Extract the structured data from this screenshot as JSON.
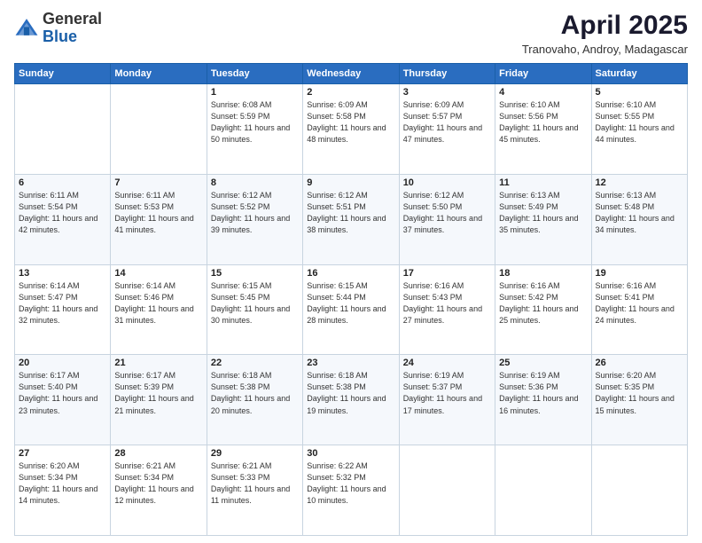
{
  "header": {
    "logo_general": "General",
    "logo_blue": "Blue",
    "month_year": "April 2025",
    "location": "Tranovaho, Androy, Madagascar"
  },
  "days_of_week": [
    "Sunday",
    "Monday",
    "Tuesday",
    "Wednesday",
    "Thursday",
    "Friday",
    "Saturday"
  ],
  "weeks": [
    [
      {
        "day": "",
        "info": ""
      },
      {
        "day": "",
        "info": ""
      },
      {
        "day": "1",
        "info": "Sunrise: 6:08 AM\nSunset: 5:59 PM\nDaylight: 11 hours and 50 minutes."
      },
      {
        "day": "2",
        "info": "Sunrise: 6:09 AM\nSunset: 5:58 PM\nDaylight: 11 hours and 48 minutes."
      },
      {
        "day": "3",
        "info": "Sunrise: 6:09 AM\nSunset: 5:57 PM\nDaylight: 11 hours and 47 minutes."
      },
      {
        "day": "4",
        "info": "Sunrise: 6:10 AM\nSunset: 5:56 PM\nDaylight: 11 hours and 45 minutes."
      },
      {
        "day": "5",
        "info": "Sunrise: 6:10 AM\nSunset: 5:55 PM\nDaylight: 11 hours and 44 minutes."
      }
    ],
    [
      {
        "day": "6",
        "info": "Sunrise: 6:11 AM\nSunset: 5:54 PM\nDaylight: 11 hours and 42 minutes."
      },
      {
        "day": "7",
        "info": "Sunrise: 6:11 AM\nSunset: 5:53 PM\nDaylight: 11 hours and 41 minutes."
      },
      {
        "day": "8",
        "info": "Sunrise: 6:12 AM\nSunset: 5:52 PM\nDaylight: 11 hours and 39 minutes."
      },
      {
        "day": "9",
        "info": "Sunrise: 6:12 AM\nSunset: 5:51 PM\nDaylight: 11 hours and 38 minutes."
      },
      {
        "day": "10",
        "info": "Sunrise: 6:12 AM\nSunset: 5:50 PM\nDaylight: 11 hours and 37 minutes."
      },
      {
        "day": "11",
        "info": "Sunrise: 6:13 AM\nSunset: 5:49 PM\nDaylight: 11 hours and 35 minutes."
      },
      {
        "day": "12",
        "info": "Sunrise: 6:13 AM\nSunset: 5:48 PM\nDaylight: 11 hours and 34 minutes."
      }
    ],
    [
      {
        "day": "13",
        "info": "Sunrise: 6:14 AM\nSunset: 5:47 PM\nDaylight: 11 hours and 32 minutes."
      },
      {
        "day": "14",
        "info": "Sunrise: 6:14 AM\nSunset: 5:46 PM\nDaylight: 11 hours and 31 minutes."
      },
      {
        "day": "15",
        "info": "Sunrise: 6:15 AM\nSunset: 5:45 PM\nDaylight: 11 hours and 30 minutes."
      },
      {
        "day": "16",
        "info": "Sunrise: 6:15 AM\nSunset: 5:44 PM\nDaylight: 11 hours and 28 minutes."
      },
      {
        "day": "17",
        "info": "Sunrise: 6:16 AM\nSunset: 5:43 PM\nDaylight: 11 hours and 27 minutes."
      },
      {
        "day": "18",
        "info": "Sunrise: 6:16 AM\nSunset: 5:42 PM\nDaylight: 11 hours and 25 minutes."
      },
      {
        "day": "19",
        "info": "Sunrise: 6:16 AM\nSunset: 5:41 PM\nDaylight: 11 hours and 24 minutes."
      }
    ],
    [
      {
        "day": "20",
        "info": "Sunrise: 6:17 AM\nSunset: 5:40 PM\nDaylight: 11 hours and 23 minutes."
      },
      {
        "day": "21",
        "info": "Sunrise: 6:17 AM\nSunset: 5:39 PM\nDaylight: 11 hours and 21 minutes."
      },
      {
        "day": "22",
        "info": "Sunrise: 6:18 AM\nSunset: 5:38 PM\nDaylight: 11 hours and 20 minutes."
      },
      {
        "day": "23",
        "info": "Sunrise: 6:18 AM\nSunset: 5:38 PM\nDaylight: 11 hours and 19 minutes."
      },
      {
        "day": "24",
        "info": "Sunrise: 6:19 AM\nSunset: 5:37 PM\nDaylight: 11 hours and 17 minutes."
      },
      {
        "day": "25",
        "info": "Sunrise: 6:19 AM\nSunset: 5:36 PM\nDaylight: 11 hours and 16 minutes."
      },
      {
        "day": "26",
        "info": "Sunrise: 6:20 AM\nSunset: 5:35 PM\nDaylight: 11 hours and 15 minutes."
      }
    ],
    [
      {
        "day": "27",
        "info": "Sunrise: 6:20 AM\nSunset: 5:34 PM\nDaylight: 11 hours and 14 minutes."
      },
      {
        "day": "28",
        "info": "Sunrise: 6:21 AM\nSunset: 5:34 PM\nDaylight: 11 hours and 12 minutes."
      },
      {
        "day": "29",
        "info": "Sunrise: 6:21 AM\nSunset: 5:33 PM\nDaylight: 11 hours and 11 minutes."
      },
      {
        "day": "30",
        "info": "Sunrise: 6:22 AM\nSunset: 5:32 PM\nDaylight: 11 hours and 10 minutes."
      },
      {
        "day": "",
        "info": ""
      },
      {
        "day": "",
        "info": ""
      },
      {
        "day": "",
        "info": ""
      }
    ]
  ]
}
